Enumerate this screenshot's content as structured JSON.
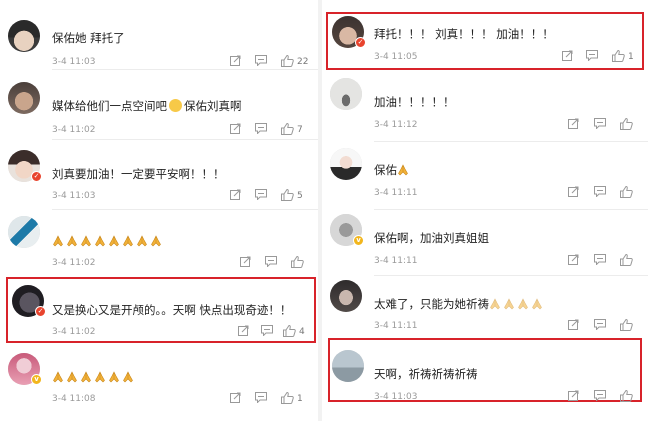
{
  "left_column": {
    "comments": [
      {
        "text": "保佑她 拜托了",
        "time": "3-4 11:03",
        "likes": "22",
        "avatar": "dark-haired-avatar",
        "badge": ""
      },
      {
        "text_before": "媒体给他们一点空间吧",
        "emoji": "smile",
        "text_after": "保佑刘真啊",
        "time": "3-4 11:02",
        "likes": "7",
        "avatar": "portrait-avatar",
        "badge": ""
      },
      {
        "text": "刘真要加油！一定要平安啊！！！",
        "time": "3-4 11:03",
        "likes": "5",
        "avatar": "girl-avatar",
        "badge": "red"
      },
      {
        "pray_count": 8,
        "time": "3-4 11:02",
        "likes": "",
        "avatar": "logo-avatar",
        "badge": ""
      },
      {
        "text": "又是换心又是开颅的。。天啊 快点出现奇迹！！",
        "time": "3-4 11:02",
        "likes": "4",
        "avatar": "dark-avatar",
        "badge": "red"
      },
      {
        "pray_count": 6,
        "time": "3-4 11:08",
        "likes": "1",
        "avatar": "flower-avatar",
        "badge": "gold"
      }
    ]
  },
  "right_column": {
    "comments": [
      {
        "text": "拜托！！！ 刘真！！！ 加油！！！",
        "time": "3-4 11:05",
        "likes": "1",
        "avatar": "dark-haired-avatar",
        "badge": "red"
      },
      {
        "text": "加油！！！！！",
        "time": "3-4 11:12",
        "likes": "",
        "avatar": "figure-avatar",
        "badge": ""
      },
      {
        "text": "保佑",
        "pray_count": 1,
        "time": "3-4 11:11",
        "likes": "",
        "avatar": "white-avatar",
        "badge": ""
      },
      {
        "text": "保佑啊，加油刘真姐姐",
        "time": "3-4 11:11",
        "likes": "",
        "avatar": "gray-avatar",
        "badge": "gold"
      },
      {
        "text": "太难了，只能为她祈祷",
        "pray_count": 4,
        "pray_light": true,
        "time": "3-4 11:11",
        "likes": "",
        "avatar": "face-avatar",
        "badge": ""
      },
      {
        "text": "天啊，祈祷祈祷祈祷",
        "time": "3-4 11:03",
        "likes": "",
        "avatar": "landscape-avatar",
        "badge": ""
      }
    ]
  },
  "icons": {
    "share": "share-icon",
    "comment": "comment-icon",
    "like": "thumbs-up-icon"
  },
  "colors": {
    "highlight": "#d8232a",
    "timestamp": "#9a9a9a",
    "text": "#222222"
  }
}
